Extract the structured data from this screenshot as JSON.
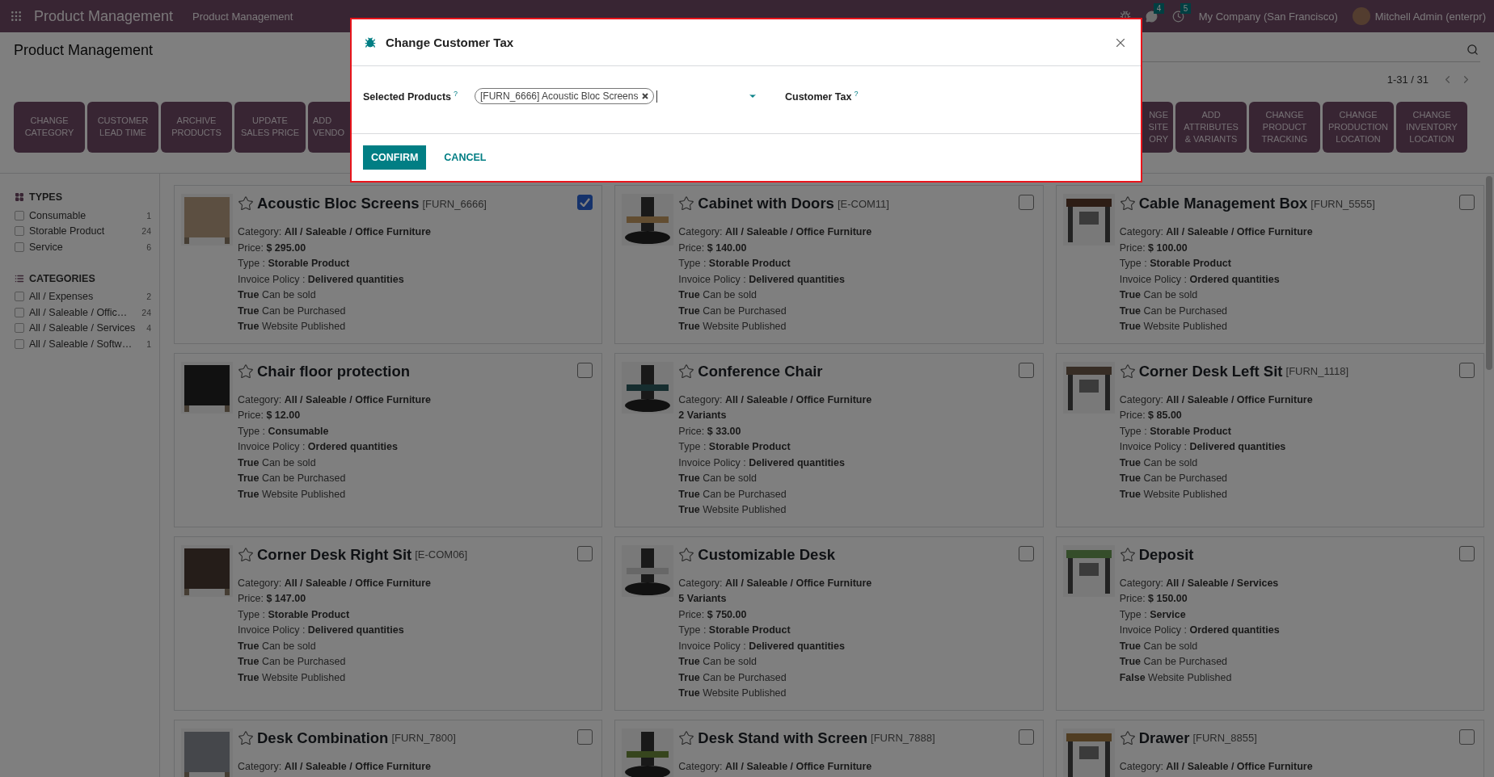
{
  "topbar": {
    "app_title": "Product Management",
    "menu": [
      "Product Management"
    ],
    "chat_count": "4",
    "activity_count": "5",
    "company": "My Company (San Francisco)",
    "user": "Mitchell Admin (enterpr)"
  },
  "page": {
    "title": "Product Management",
    "pager": "1-31 / 31"
  },
  "actions_left": [
    {
      "kind": "full",
      "lines": [
        "CHANGE",
        "CATEGORY"
      ]
    },
    {
      "kind": "full",
      "lines": [
        "CUSTOMER",
        "LEAD TIME"
      ]
    },
    {
      "kind": "full",
      "lines": [
        "ARCHIVE",
        "PRODUCTS"
      ]
    },
    {
      "kind": "full",
      "lines": [
        "UPDATE",
        "SALES PRICE"
      ]
    },
    {
      "kind": "cut_right",
      "lines": [
        "ADD",
        "VENDO"
      ]
    }
  ],
  "actions_right": [
    {
      "kind": "cut_left",
      "lines": [
        "NGE",
        "SITE",
        "ORY"
      ]
    },
    {
      "kind": "full",
      "lines": [
        "ADD",
        "ATTRIBUTES",
        "& VARIANTS"
      ]
    },
    {
      "kind": "full",
      "lines": [
        "CHANGE",
        "PRODUCT",
        "TRACKING"
      ]
    },
    {
      "kind": "full",
      "lines": [
        "CHANGE",
        "PRODUCTION",
        "LOCATION"
      ]
    },
    {
      "kind": "full",
      "lines": [
        "CHANGE",
        "INVENTORY",
        "LOCATION"
      ]
    }
  ],
  "sidebar": [
    {
      "kind": "types",
      "title": "TYPES",
      "items": [
        {
          "label": "Consumable",
          "count": "1",
          "checked": false
        },
        {
          "label": "Storable Product",
          "count": "24",
          "checked": false
        },
        {
          "label": "Service",
          "count": "6",
          "checked": false
        }
      ]
    },
    {
      "kind": "categories",
      "title": "CATEGORIES",
      "items": [
        {
          "label": "All / Expenses",
          "count": "2",
          "checked": false
        },
        {
          "label": "All / Saleable / Offic…",
          "count": "24",
          "checked": false
        },
        {
          "label": "All / Saleable / Services",
          "count": "4",
          "checked": false
        },
        {
          "label": "All / Saleable / Softw…",
          "count": "1",
          "checked": false
        }
      ]
    }
  ],
  "cards": [
    {
      "name": "Acoustic Bloc Screens",
      "code": "[FURN_6666]",
      "checked": true,
      "lines": [
        "Category: **All / Saleable / Office Furniture**",
        "Price: **$ 295.00**",
        "Type : **Storable Product**",
        "Invoice Policy : **Delivered quantities**",
        "**True** Can be sold",
        "**True** Can be Purchased",
        "**True** Website Published"
      ]
    },
    {
      "name": "Cabinet with Doors",
      "code": "[E-COM11]",
      "checked": false,
      "lines": [
        "Category: **All / Saleable / Office Furniture**",
        "Price: **$ 140.00**",
        "Type : **Storable Product**",
        "Invoice Policy : **Delivered quantities**",
        "**True** Can be sold",
        "**True** Can be Purchased",
        "**True** Website Published"
      ]
    },
    {
      "name": "Cable Management Box",
      "code": "[FURN_5555]",
      "checked": false,
      "lines": [
        "Category: **All / Saleable / Office Furniture**",
        "Price: **$ 100.00**",
        "Type : **Storable Product**",
        "Invoice Policy : **Ordered quantities**",
        "**True** Can be sold",
        "**True** Can be Purchased",
        "**True** Website Published"
      ]
    },
    {
      "name": "Chair floor protection",
      "checked": false,
      "lines": [
        "Category: **All / Saleable / Office Furniture**",
        "Price: **$ 12.00**",
        "Type : **Consumable**",
        "Invoice Policy : **Ordered quantities**",
        "**True** Can be sold",
        "**True** Can be Purchased",
        "**True** Website Published"
      ]
    },
    {
      "name": "Conference Chair",
      "checked": false,
      "lines": [
        "Category: **All / Saleable / Office Furniture**",
        "**2 Variants**",
        "Price: **$ 33.00**",
        "Type : **Storable Product**",
        "Invoice Policy : **Delivered quantities**",
        "**True** Can be sold",
        "**True** Can be Purchased",
        "**True** Website Published"
      ]
    },
    {
      "name": "Corner Desk Left Sit",
      "code": "[FURN_1118]",
      "checked": false,
      "lines": [
        "Category: **All / Saleable / Office Furniture**",
        "Price: **$ 85.00**",
        "Type : **Storable Product**",
        "Invoice Policy : **Delivered quantities**",
        "**True** Can be sold",
        "**True** Can be Purchased",
        "**True** Website Published"
      ]
    },
    {
      "name": "Corner Desk Right Sit",
      "code": "[E-COM06]",
      "checked": false,
      "lines": [
        "Category: **All / Saleable / Office Furniture**",
        "Price: **$ 147.00**",
        "Type : **Storable Product**",
        "Invoice Policy : **Delivered quantities**",
        "**True** Can be sold",
        "**True** Can be Purchased",
        "**True** Website Published"
      ]
    },
    {
      "name": "Customizable Desk",
      "checked": false,
      "lines": [
        "Category: **All / Saleable / Office Furniture**",
        "**5 Variants**",
        "Price: **$ 750.00**",
        "Type : **Storable Product**",
        "Invoice Policy : **Delivered quantities**",
        "**True** Can be sold",
        "**True** Can be Purchased",
        "**True** Website Published"
      ]
    },
    {
      "name": "Deposit",
      "checked": false,
      "lines": [
        "Category: **All / Saleable / Services**",
        "Price: **$ 150.00**",
        "Type : **Service**",
        "Invoice Policy : **Ordered quantities**",
        "**True** Can be sold",
        "**True** Can be Purchased",
        "**False** Website Published"
      ]
    },
    {
      "name": "Desk Combination",
      "code": "[FURN_7800]",
      "checked": false,
      "lines": [
        "Category: **All / Saleable / Office Furniture**"
      ]
    },
    {
      "name": "Desk Stand with Screen",
      "code": "[FURN_7888]",
      "checked": false,
      "lines": [
        "Category: **All / Saleable / Office Furniture**"
      ]
    },
    {
      "name": "Drawer",
      "code": "[FURN_8855]",
      "checked": false,
      "lines": [
        "Category: **All / Saleable / Office Furniture**"
      ]
    }
  ],
  "modal": {
    "title": "Change Customer Tax",
    "fields": [
      {
        "kind": "tags",
        "label": "Selected Products",
        "help": "?",
        "tags": [
          "[FURN_6666] Acoustic Bloc Screens"
        ]
      },
      {
        "kind": "empty",
        "label": "Customer Tax",
        "help": "?"
      }
    ],
    "buttons": [
      {
        "label": "CONFIRM",
        "primary": true
      },
      {
        "label": "CANCEL",
        "primary": false
      }
    ]
  }
}
